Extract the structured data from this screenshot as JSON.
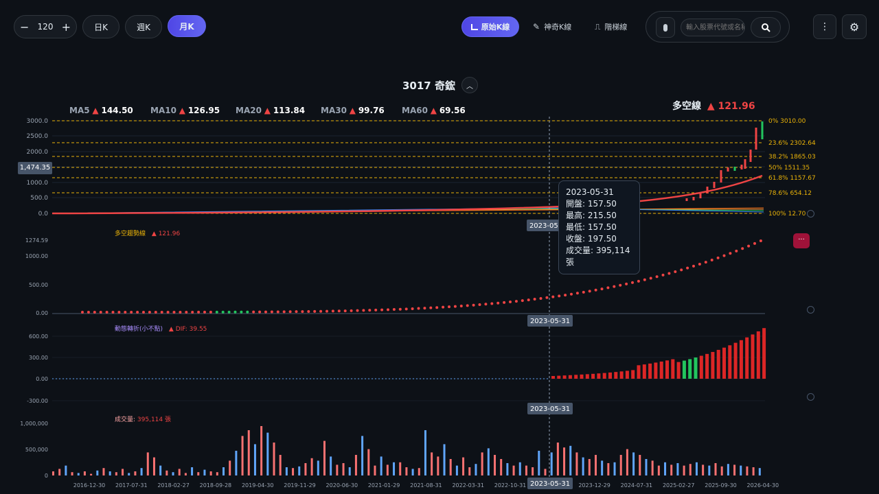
{
  "toolbar": {
    "count_value": "120",
    "minus": "−",
    "plus": "+",
    "tabs": [
      "日K",
      "週K",
      "月K"
    ],
    "active_tab": "月K",
    "modes": [
      "原始K線",
      "神奇K線",
      "階梯線"
    ],
    "search_placeholder": "輸入股票代號或名稱"
  },
  "title": "3017 奇鋐",
  "ma": [
    {
      "label": "MA5",
      "arrow": "▲",
      "value": "144.50"
    },
    {
      "label": "MA10",
      "arrow": "▲",
      "value": "126.95"
    },
    {
      "label": "MA20",
      "arrow": "▲",
      "value": "113.84"
    },
    {
      "label": "MA30",
      "arrow": "▲",
      "value": "99.76"
    },
    {
      "label": "MA60",
      "arrow": "▲",
      "value": "69.56"
    }
  ],
  "trend_line": {
    "label": "多空線",
    "arrow": "▲",
    "value": "121.96"
  },
  "price_axis": [
    "3000.0",
    "2500.0",
    "2000.0",
    "1500.0",
    "1000.0",
    "500.0",
    "0.0"
  ],
  "price_marker": "1,474.35",
  "fib": [
    {
      "pct": "0%",
      "value": "3010.00"
    },
    {
      "pct": "23.6%",
      "value": "2302.64"
    },
    {
      "pct": "38.2%",
      "value": "1865.03"
    },
    {
      "pct": "50%",
      "value": "1511.35"
    },
    {
      "pct": "61.8%",
      "value": "1157.67"
    },
    {
      "pct": "78.6%",
      "value": "654.12"
    },
    {
      "pct": "100%",
      "value": "12.70"
    }
  ],
  "tooltip": {
    "date": "2023-05-31",
    "rows": [
      "開盤: 157.50",
      "最高: 215.50",
      "最低: 157.50",
      "收盤: 197.50",
      "成交量: 395,114 張"
    ]
  },
  "cursor_date": "2023-05-31",
  "panel2": {
    "label": "多空趨勢線",
    "arrow": "▲",
    "value": "121.96",
    "axis": [
      "1274.59",
      "1000.00",
      "500.00",
      "0.00"
    ]
  },
  "panel3": {
    "label": "動態轉折(小不點)",
    "dif": "▲ DIF: 39.55",
    "axis": [
      "600.00",
      "300.00",
      "0.00",
      "-300.00"
    ]
  },
  "panel4": {
    "label": "成交量:",
    "value": "395,114 張",
    "axis": [
      "1,000,000",
      "500,000",
      "0"
    ]
  },
  "x_dates": [
    "2016-12-30",
    "2017-07-31",
    "2018-02-27",
    "2018-09-28",
    "2019-04-30",
    "2019-11-29",
    "2020-06-30",
    "2021-01-29",
    "2021-08-31",
    "2022-03-31",
    "2022-10-31",
    "2023-05-31",
    "2023-12-29",
    "2024-07-31",
    "2025-02-27",
    "2025-09-30",
    "2026-04-30"
  ],
  "colors": {
    "up": "#ef4444",
    "down": "#22c55e",
    "accent": "#6366f1",
    "fib": "#eab308",
    "volume_down": "#60a5fa"
  },
  "icons": [
    "minus-icon",
    "plus-icon",
    "chart-icon",
    "pencil-icon",
    "step-icon",
    "mic-icon",
    "search-icon",
    "more-icon",
    "gear-icon"
  ]
}
